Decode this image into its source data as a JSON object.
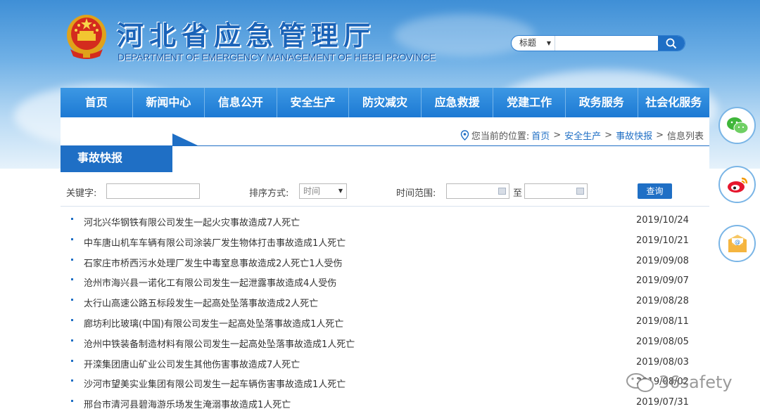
{
  "header": {
    "title": "河北省应急管理厅",
    "subtitle": "DEPARTMENT OF EMERGENCY MANAGEMENT OF HEBEI PROVINCE",
    "colors": {
      "brand": "#1a63b8",
      "nav": "#1f6fc5"
    }
  },
  "search": {
    "field_option": "标题",
    "query": "",
    "button_icon": "search-icon"
  },
  "nav": {
    "items": [
      {
        "label": "首页"
      },
      {
        "label": "新闻中心"
      },
      {
        "label": "信息公开"
      },
      {
        "label": "安全生产"
      },
      {
        "label": "防灾减灾"
      },
      {
        "label": "应急救援"
      },
      {
        "label": "党建工作"
      },
      {
        "label": "政务服务"
      },
      {
        "label": "社会化服务"
      }
    ]
  },
  "breadcrumb": {
    "prefix": "您当前的位置:",
    "crumbs": [
      "首页",
      "安全生产",
      "事故快报"
    ],
    "current": "信息列表",
    "separator": ">"
  },
  "section": {
    "title": "事故快报"
  },
  "filters": {
    "keyword_label": "关键字:",
    "keyword_value": "",
    "sort_label": "排序方式:",
    "sort_value": "时间",
    "range_label": "时间范围:",
    "range_to": "至",
    "range_from_value": "",
    "range_to_value": "",
    "query_button": "查询"
  },
  "news": [
    {
      "title": "河北兴华钢铁有限公司发生一起火灾事故造成7人死亡",
      "date": "2019/10/24"
    },
    {
      "title": "中车唐山机车车辆有限公司涂装厂发生物体打击事故造成1人死亡",
      "date": "2019/10/21"
    },
    {
      "title": "石家庄市桥西污水处理厂发生中毒窒息事故造成2人死亡1人受伤",
      "date": "2019/09/08"
    },
    {
      "title": "沧州市海兴县一诺化工有限公司发生一起泄露事故造成4人受伤",
      "date": "2019/09/07"
    },
    {
      "title": "太行山高速公路五标段发生一起高处坠落事故造成2人死亡",
      "date": "2019/08/28"
    },
    {
      "title": "廊坊利比玻璃(中国)有限公司发生一起高处坠落事故造成1人死亡",
      "date": "2019/08/11"
    },
    {
      "title": "沧州中铁装备制造材料有限公司发生一起高处坠落事故造成1人死亡",
      "date": "2019/08/05"
    },
    {
      "title": "开滦集团唐山矿业公司发生其他伤害事故造成7人死亡",
      "date": "2019/08/03"
    },
    {
      "title": "沙河市望美实业集团有限公司发生一起车辆伤害事故造成1人死亡",
      "date": "2019/08/02"
    },
    {
      "title": "邢台市清河县碧海游乐场发生淹溺事故造成1人死亡",
      "date": "2019/07/31"
    }
  ],
  "social": {
    "icons": [
      "wechat-icon",
      "weibo-icon",
      "email-icon"
    ]
  },
  "watermark": {
    "text": "36safety"
  }
}
